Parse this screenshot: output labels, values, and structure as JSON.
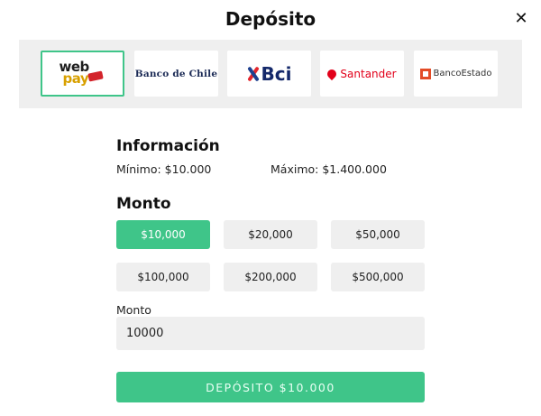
{
  "modal": {
    "title": "Depósito",
    "close_icon": "close-icon"
  },
  "banks": [
    {
      "name": "webpay",
      "text_top": "web",
      "text_bottom": "pay",
      "selected": true
    },
    {
      "name": "Banco de Chile",
      "text": "Banco de Chile",
      "selected": false
    },
    {
      "name": "Bci",
      "text": "Bci",
      "selected": false
    },
    {
      "name": "Santander",
      "text": "Santander",
      "selected": false
    },
    {
      "name": "BancoEstado",
      "text": "BancoEstado",
      "selected": false
    }
  ],
  "info": {
    "heading": "Información",
    "min_label": "Mínimo: $10.000",
    "max_label": "Máximo: $1.400.000"
  },
  "amount": {
    "heading": "Monto",
    "options": [
      "$10,000",
      "$20,000",
      "$50,000",
      "$100,000",
      "$200,000",
      "$500,000"
    ],
    "selected_index": 0,
    "field_label": "Monto",
    "field_value": "10000"
  },
  "submit_label": "DEPÓSITO $10.000",
  "colors": {
    "accent": "#3fc589",
    "panel": "#efefef"
  }
}
